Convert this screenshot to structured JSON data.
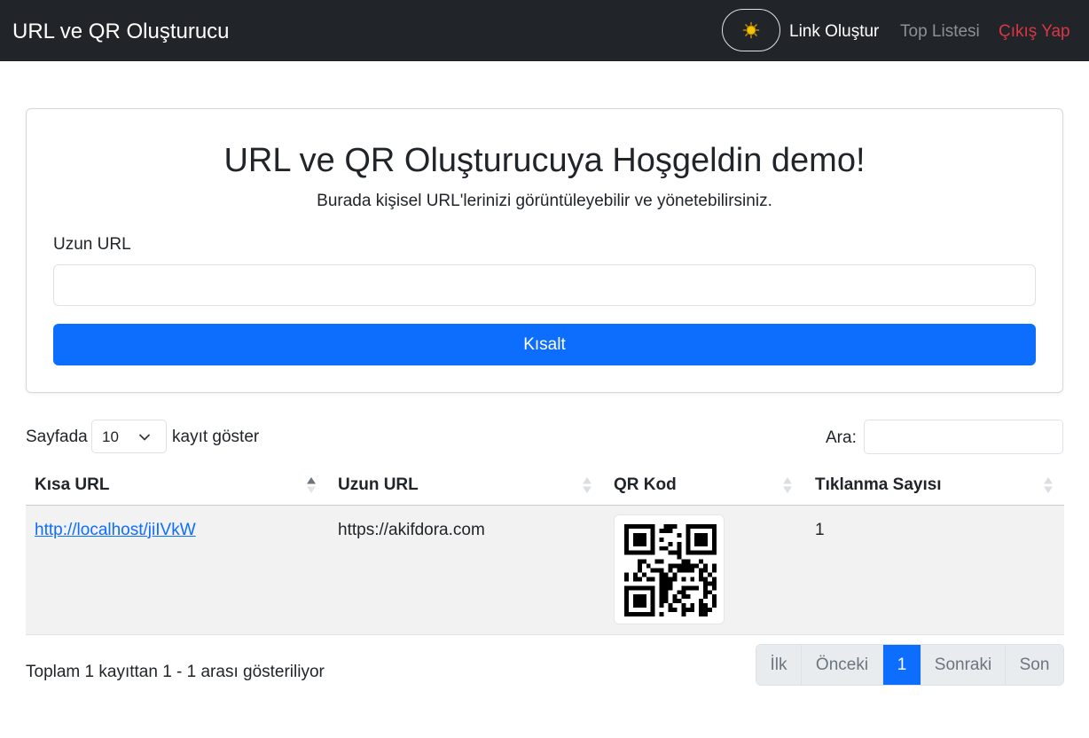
{
  "navbar": {
    "brand": "URL ve QR Oluşturucu",
    "links": {
      "create": "Link Oluştur",
      "top": "Top Listesi",
      "logout": "Çıkış Yap"
    }
  },
  "form": {
    "title": "URL ve QR Oluşturucuya Hoşgeldin demo!",
    "subtitle": "Burada kişisel URL'lerinizi görüntüleyebilir ve yönetebilirsiniz.",
    "url_label": "Uzun URL",
    "url_value": "",
    "submit_label": "Kısalt"
  },
  "table_controls": {
    "length_prefix": "Sayfada",
    "length_value": "10",
    "length_suffix": "kayıt göster",
    "search_label": "Ara:",
    "search_value": ""
  },
  "table": {
    "columns": [
      "Kısa URL",
      "Uzun URL",
      "QR Kod",
      "Tıklanma Sayısı"
    ],
    "rows": [
      {
        "short_url": "http://localhost/jiIVkW",
        "long_url": "https://akifdora.com",
        "clicks": "1"
      }
    ]
  },
  "footer": {
    "info": "Toplam 1 kayıttan 1 - 1 arası gösteriliyor",
    "pagination": [
      "İlk",
      "Önceki",
      "1",
      "Sonraki",
      "Son"
    ]
  },
  "colors": {
    "navbar_bg": "#212529",
    "primary": "#0d6efd",
    "danger": "#dc3545",
    "muted_link": "#8c9196",
    "row_bg": "#f2f2f2"
  },
  "icons": {
    "theme_toggle": "sun-icon",
    "select": "chevron-down-icon",
    "sort_active": "sort-asc-icon",
    "sort_inactive": "sort-both-icon"
  }
}
